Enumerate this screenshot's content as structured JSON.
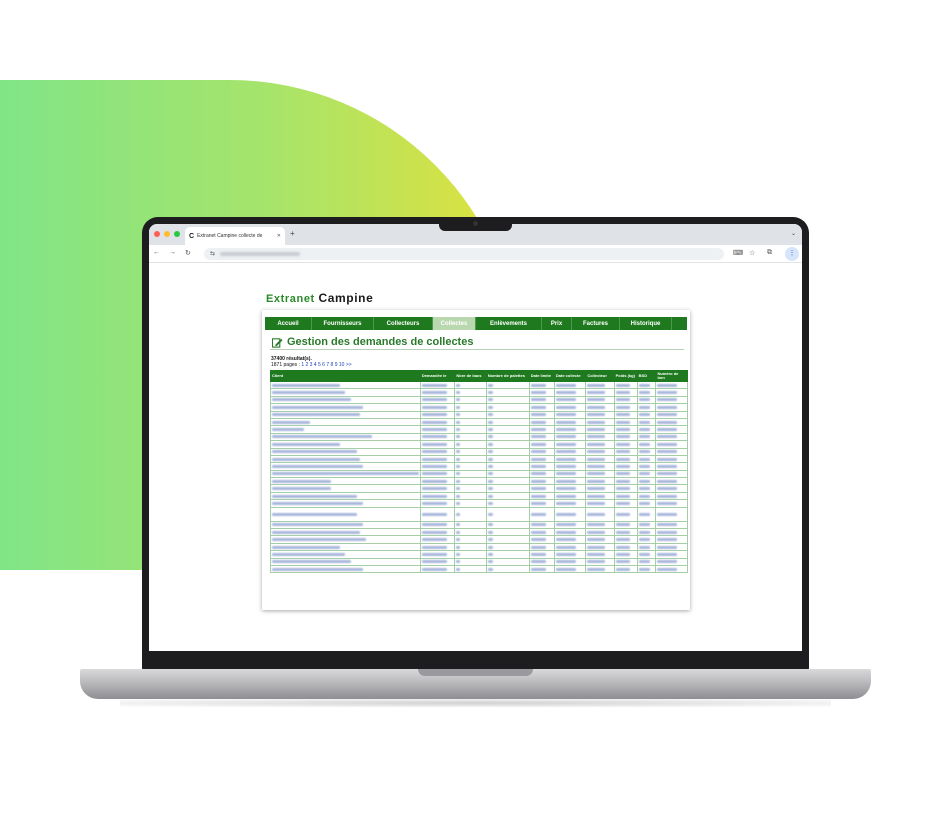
{
  "colors": {
    "brand_green": "#1f7a1f",
    "gradient_start": "#7ae58b",
    "gradient_end": "#e3e13a",
    "link_blue": "#1a3fc0"
  },
  "browser": {
    "tab_title": "Extranet Campine collecte de",
    "tab_favicon": "C",
    "new_tab_icon": "plus-icon",
    "toolbar_icons": [
      "back-icon",
      "forward-icon",
      "reload-icon",
      "site-settings-icon",
      "translate-icon",
      "star-icon",
      "extensions-icon",
      "menu-icon"
    ]
  },
  "page": {
    "brand_prefix": "Extranet",
    "brand_name": "Campine",
    "menu": [
      "Accueil",
      "Fournisseurs",
      "Collecteurs",
      "Collectes",
      "Enlèvements",
      "Prix",
      "Factures",
      "Historique"
    ],
    "active_menu": "Collectes",
    "title": "Gestion des demandes de collectes",
    "results_count": "37400 résultat(s).",
    "pages_prefix": "1871 pages :",
    "pages_links": [
      "1",
      "2",
      "3",
      "4",
      "5",
      "6",
      "7",
      "8",
      "9",
      "10",
      ">>"
    ],
    "columns": [
      "Client",
      "Demandée le",
      "Nbre de bacs",
      "Nombre de palettes",
      "Date limite",
      "Date collecte",
      "Collecteur",
      "Poids (kg)",
      "BSD",
      "Numéro de bon"
    ],
    "row_count": 25,
    "tall_rows": [
      17
    ]
  }
}
